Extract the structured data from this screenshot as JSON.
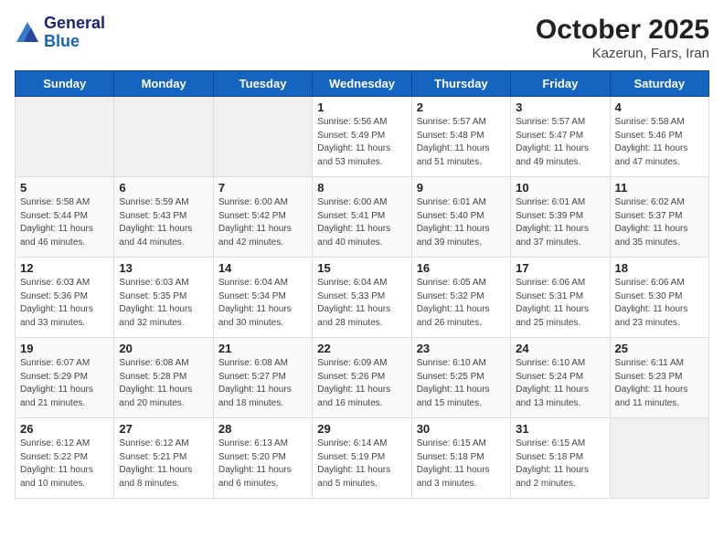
{
  "header": {
    "logo_line1": "General",
    "logo_line2": "Blue",
    "title": "October 2025",
    "subtitle": "Kazerun, Fars, Iran"
  },
  "weekdays": [
    "Sunday",
    "Monday",
    "Tuesday",
    "Wednesday",
    "Thursday",
    "Friday",
    "Saturday"
  ],
  "weeks": [
    [
      {
        "day": "",
        "info": ""
      },
      {
        "day": "",
        "info": ""
      },
      {
        "day": "",
        "info": ""
      },
      {
        "day": "1",
        "info": "Sunrise: 5:56 AM\nSunset: 5:49 PM\nDaylight: 11 hours and 53 minutes."
      },
      {
        "day": "2",
        "info": "Sunrise: 5:57 AM\nSunset: 5:48 PM\nDaylight: 11 hours and 51 minutes."
      },
      {
        "day": "3",
        "info": "Sunrise: 5:57 AM\nSunset: 5:47 PM\nDaylight: 11 hours and 49 minutes."
      },
      {
        "day": "4",
        "info": "Sunrise: 5:58 AM\nSunset: 5:46 PM\nDaylight: 11 hours and 47 minutes."
      }
    ],
    [
      {
        "day": "5",
        "info": "Sunrise: 5:58 AM\nSunset: 5:44 PM\nDaylight: 11 hours and 46 minutes."
      },
      {
        "day": "6",
        "info": "Sunrise: 5:59 AM\nSunset: 5:43 PM\nDaylight: 11 hours and 44 minutes."
      },
      {
        "day": "7",
        "info": "Sunrise: 6:00 AM\nSunset: 5:42 PM\nDaylight: 11 hours and 42 minutes."
      },
      {
        "day": "8",
        "info": "Sunrise: 6:00 AM\nSunset: 5:41 PM\nDaylight: 11 hours and 40 minutes."
      },
      {
        "day": "9",
        "info": "Sunrise: 6:01 AM\nSunset: 5:40 PM\nDaylight: 11 hours and 39 minutes."
      },
      {
        "day": "10",
        "info": "Sunrise: 6:01 AM\nSunset: 5:39 PM\nDaylight: 11 hours and 37 minutes."
      },
      {
        "day": "11",
        "info": "Sunrise: 6:02 AM\nSunset: 5:37 PM\nDaylight: 11 hours and 35 minutes."
      }
    ],
    [
      {
        "day": "12",
        "info": "Sunrise: 6:03 AM\nSunset: 5:36 PM\nDaylight: 11 hours and 33 minutes."
      },
      {
        "day": "13",
        "info": "Sunrise: 6:03 AM\nSunset: 5:35 PM\nDaylight: 11 hours and 32 minutes."
      },
      {
        "day": "14",
        "info": "Sunrise: 6:04 AM\nSunset: 5:34 PM\nDaylight: 11 hours and 30 minutes."
      },
      {
        "day": "15",
        "info": "Sunrise: 6:04 AM\nSunset: 5:33 PM\nDaylight: 11 hours and 28 minutes."
      },
      {
        "day": "16",
        "info": "Sunrise: 6:05 AM\nSunset: 5:32 PM\nDaylight: 11 hours and 26 minutes."
      },
      {
        "day": "17",
        "info": "Sunrise: 6:06 AM\nSunset: 5:31 PM\nDaylight: 11 hours and 25 minutes."
      },
      {
        "day": "18",
        "info": "Sunrise: 6:06 AM\nSunset: 5:30 PM\nDaylight: 11 hours and 23 minutes."
      }
    ],
    [
      {
        "day": "19",
        "info": "Sunrise: 6:07 AM\nSunset: 5:29 PM\nDaylight: 11 hours and 21 minutes."
      },
      {
        "day": "20",
        "info": "Sunrise: 6:08 AM\nSunset: 5:28 PM\nDaylight: 11 hours and 20 minutes."
      },
      {
        "day": "21",
        "info": "Sunrise: 6:08 AM\nSunset: 5:27 PM\nDaylight: 11 hours and 18 minutes."
      },
      {
        "day": "22",
        "info": "Sunrise: 6:09 AM\nSunset: 5:26 PM\nDaylight: 11 hours and 16 minutes."
      },
      {
        "day": "23",
        "info": "Sunrise: 6:10 AM\nSunset: 5:25 PM\nDaylight: 11 hours and 15 minutes."
      },
      {
        "day": "24",
        "info": "Sunrise: 6:10 AM\nSunset: 5:24 PM\nDaylight: 11 hours and 13 minutes."
      },
      {
        "day": "25",
        "info": "Sunrise: 6:11 AM\nSunset: 5:23 PM\nDaylight: 11 hours and 11 minutes."
      }
    ],
    [
      {
        "day": "26",
        "info": "Sunrise: 6:12 AM\nSunset: 5:22 PM\nDaylight: 11 hours and 10 minutes."
      },
      {
        "day": "27",
        "info": "Sunrise: 6:12 AM\nSunset: 5:21 PM\nDaylight: 11 hours and 8 minutes."
      },
      {
        "day": "28",
        "info": "Sunrise: 6:13 AM\nSunset: 5:20 PM\nDaylight: 11 hours and 6 minutes."
      },
      {
        "day": "29",
        "info": "Sunrise: 6:14 AM\nSunset: 5:19 PM\nDaylight: 11 hours and 5 minutes."
      },
      {
        "day": "30",
        "info": "Sunrise: 6:15 AM\nSunset: 5:18 PM\nDaylight: 11 hours and 3 minutes."
      },
      {
        "day": "31",
        "info": "Sunrise: 6:15 AM\nSunset: 5:18 PM\nDaylight: 11 hours and 2 minutes."
      },
      {
        "day": "",
        "info": ""
      }
    ]
  ]
}
